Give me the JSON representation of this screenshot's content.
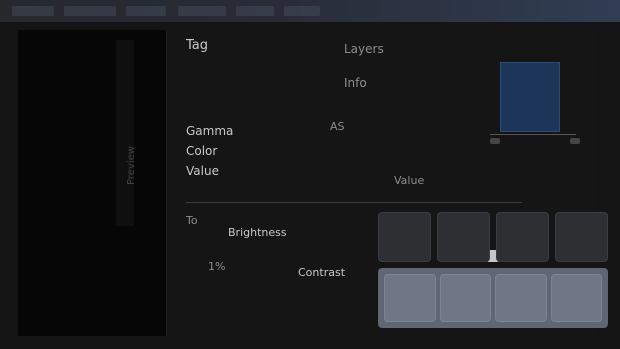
{
  "title_bar": {
    "tabs": [
      "",
      "",
      "",
      "",
      "",
      ""
    ]
  },
  "left_panel": {
    "vertical_label": "Preview"
  },
  "main": {
    "header": {
      "title": "Tag"
    },
    "right_header": {
      "line1": "Layers",
      "line2": "Info"
    },
    "left_block": {
      "line1": "Gamma",
      "line2": "Color",
      "line3": "Value"
    },
    "misc": {
      "label_a": "AS",
      "label_b": "Value"
    },
    "bottom_controls": {
      "label1": "To",
      "label2": "Brightness",
      "label3": "1%",
      "label4": "Contrast"
    }
  },
  "mini_chart": {
    "level": 0.75
  },
  "grid": {
    "rows": 2,
    "cols": 4
  }
}
